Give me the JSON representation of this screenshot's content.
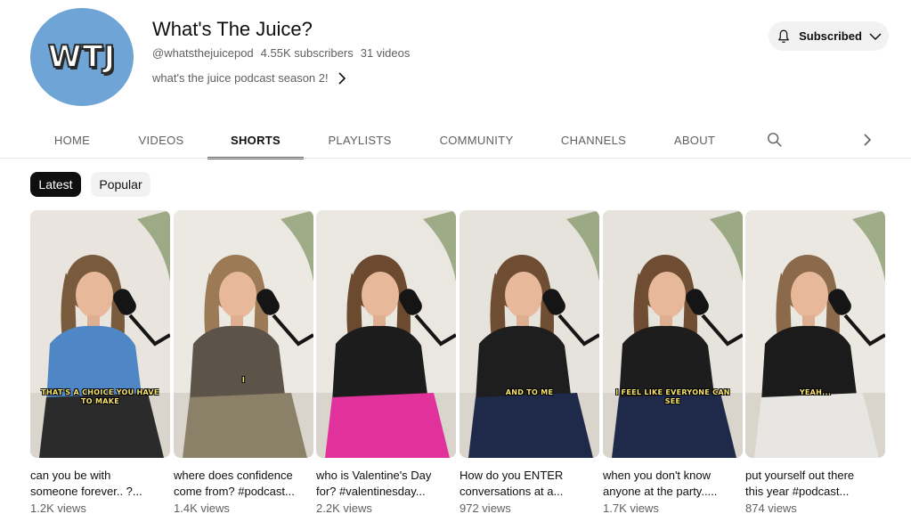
{
  "channel": {
    "avatar_text": "WTJ",
    "title": "What's The Juice?",
    "handle": "@whatsthejuicepod",
    "subscribers": "4.55K subscribers",
    "videos": "31 videos",
    "description": "what's the juice podcast season 2!",
    "subscribe_label": "Subscribed"
  },
  "tabs": [
    {
      "label": "HOME",
      "active": false
    },
    {
      "label": "VIDEOS",
      "active": false
    },
    {
      "label": "SHORTS",
      "active": true
    },
    {
      "label": "PLAYLISTS",
      "active": false
    },
    {
      "label": "COMMUNITY",
      "active": false
    },
    {
      "label": "CHANNELS",
      "active": false
    },
    {
      "label": "ABOUT",
      "active": false
    }
  ],
  "chips": [
    {
      "label": "Latest",
      "active": true
    },
    {
      "label": "Popular",
      "active": false
    }
  ],
  "shorts": [
    {
      "title_1": "can you be with",
      "title_2": "someone forever.. ?...",
      "views": "1.2K views",
      "caption": "THAT'S A CHOICE YOU HAVE TO MAKE",
      "top_color": "#4f86c6",
      "bottom_color": "#2b2b2b",
      "hair_color": "#7a5a3c",
      "bg_color": "#e9e5de"
    },
    {
      "title_1": "where does confidence",
      "title_2": "come from? #podcast...",
      "views": "1.4K views",
      "caption": "I",
      "top_color": "#5c5349",
      "bottom_color": "#8b8068",
      "hair_color": "#9b7a55",
      "bg_color": "#ece9e3"
    },
    {
      "title_1": "who is Valentine's Day",
      "title_2": "for? #valentinesday...",
      "views": "2.2K views",
      "caption": "",
      "top_color": "#1c1c1c",
      "bottom_color": "#e0329a",
      "hair_color": "#6b4a2f",
      "bg_color": "#eae6e0"
    },
    {
      "title_1": "How do you ENTER",
      "title_2": "conversations at a...",
      "views": "972 views",
      "caption": "AND TO ME",
      "top_color": "#1e1e1e",
      "bottom_color": "#1f2a4a",
      "hair_color": "#6e4d33",
      "bg_color": "#e6e2dc"
    },
    {
      "title_1": "when you don't know",
      "title_2": "anyone at the party.....",
      "views": "1.7K views",
      "caption": "I FEEL LIKE EVERYONE CAN SEE",
      "top_color": "#1d1d1d",
      "bottom_color": "#1f2a4a",
      "hair_color": "#6e4d33",
      "bg_color": "#e6e2dc"
    },
    {
      "title_1": "put yourself out there",
      "title_2": "this year #podcast...",
      "views": "874 views",
      "caption": "YEAH...",
      "top_color": "#1b1b1b",
      "bottom_color": "#e8e6e3",
      "hair_color": "#8a6a4a",
      "bg_color": "#ebe8e2"
    }
  ],
  "colors": {
    "avatar_bg": "#6fa5d6",
    "text_primary": "#0f0f0f",
    "text_secondary": "#606060",
    "chip_active_bg": "#0f0f0f",
    "chip_inactive_bg": "#f2f2f2",
    "caption_yellow": "#f6e36b"
  },
  "icons": {
    "bell": "bell-icon",
    "chevron_down": "chevron-down-icon",
    "chevron_right": "chevron-right-icon",
    "search": "search-icon"
  }
}
